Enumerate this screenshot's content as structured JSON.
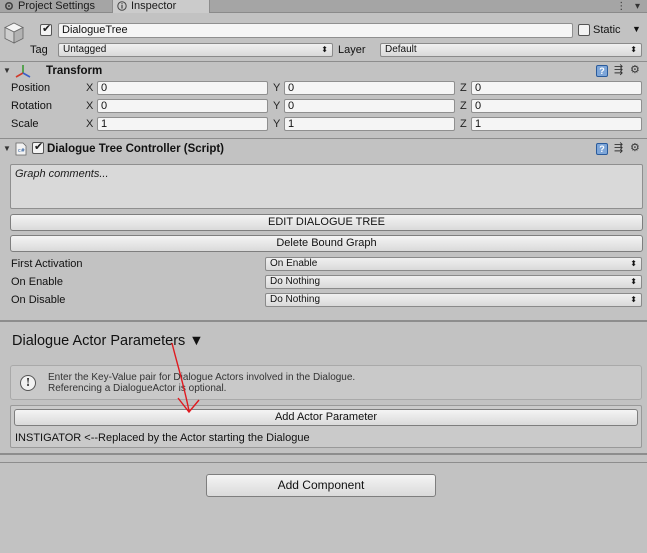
{
  "tabs": [
    {
      "label": "Project Settings",
      "icon": "gear-icon"
    },
    {
      "label": "Inspector",
      "icon": "info-icon"
    }
  ],
  "window_controls": "⋮ ▾",
  "header": {
    "object_name": "DialogueTree",
    "active_checked": true,
    "static_label": "Static",
    "static_checked": false,
    "tag_label": "Tag",
    "tag_value": "Untagged",
    "layer_label": "Layer",
    "layer_value": "Default"
  },
  "transform": {
    "title": "Transform",
    "rows": [
      {
        "label": "Position",
        "x": "0",
        "y": "0",
        "z": "0"
      },
      {
        "label": "Rotation",
        "x": "0",
        "y": "0",
        "z": "0"
      },
      {
        "label": "Scale",
        "x": "1",
        "y": "1",
        "z": "1"
      }
    ],
    "axis_labels": [
      "X",
      "Y",
      "Z"
    ]
  },
  "controller": {
    "title": "Dialogue Tree Controller (Script)",
    "enabled": true,
    "comments_placeholder": "Graph comments...",
    "edit_button": "EDIT DIALOGUE TREE",
    "delete_button": "Delete Bound Graph",
    "settings": [
      {
        "label": "First Activation",
        "value": "On Enable"
      },
      {
        "label": "On Enable",
        "value": "Do Nothing"
      },
      {
        "label": "On Disable",
        "value": "Do Nothing"
      }
    ]
  },
  "actors": {
    "title": "Dialogue Actor Parameters ▼",
    "help_line1": "Enter the Key-Value pair for Dialogue Actors involved in the Dialogue.",
    "help_line2": "Referencing a DialogueActor is optional.",
    "add_button": "Add Actor Parameter",
    "instigator_text": "INSTIGATOR <--Replaced by the Actor starting the Dialogue"
  },
  "add_component_label": "Add Component",
  "colors": {
    "background": "#c2c2c2",
    "annotation_arrow": "#e0191f",
    "transform_icon_red": "#d23a2a",
    "transform_icon_green": "#3c9a34",
    "transform_icon_blue": "#3a5fc8"
  }
}
